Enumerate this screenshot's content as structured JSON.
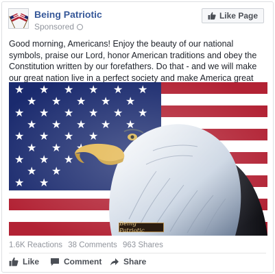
{
  "post": {
    "page_name": "Being Patriotic",
    "sponsored_label": "Sponsored",
    "like_page_label": "Like Page",
    "text": "Good morning, Americans! Enjoy the beauty of our national symbols, praise our Lord, honor American traditions and obey the Constitution written by our forefathers. Do that - and we will make our great nation live in a perfect society and make America great again.",
    "image": {
      "description_icon": "eagle-and-flag-image",
      "watermark": "Being Patriotic"
    }
  },
  "stats": {
    "reactions": "1.6K Reactions",
    "comments": "38 Comments",
    "shares": "963 Shares"
  },
  "actions": {
    "like": "Like",
    "comment": "Comment",
    "share": "Share"
  },
  "colors": {
    "link_blue": "#365899",
    "muted_gray": "#90949c",
    "action_gray": "#4b4f56",
    "flag_red": "#b22234",
    "flag_blue": "#1a2a6e"
  }
}
